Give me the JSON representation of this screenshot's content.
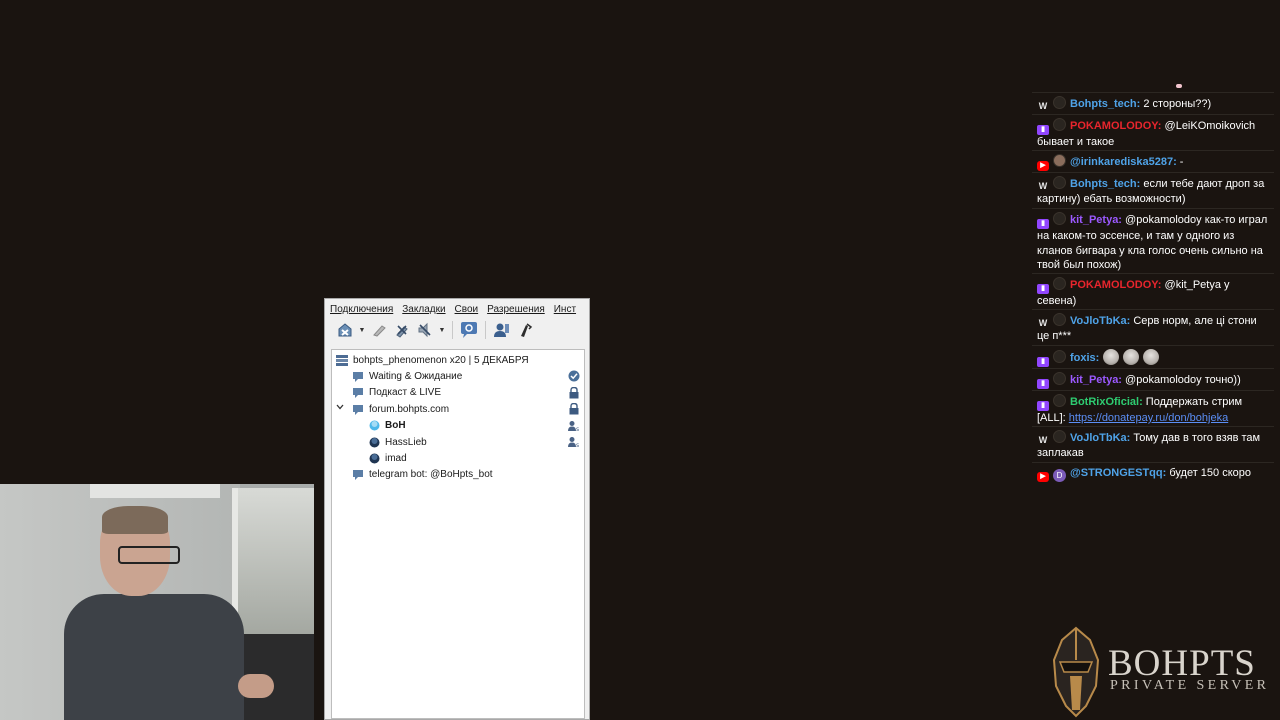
{
  "menu": [
    "Подключения",
    "Закладки",
    "Свои",
    "Разрешения",
    "Инст"
  ],
  "toolbar": {
    "icons": [
      "disconnect-icon",
      "bookmark-icon",
      "mute-mic-icon",
      "mute-speakers-icon",
      "away-icon",
      "contacts-icon",
      "whisper-icon"
    ]
  },
  "tree": {
    "server": "bohpts_phenomenon x20 | 5 ДЕКАБРЯ",
    "channels": [
      {
        "name": "Waiting & Ожидание",
        "right_icon": "check-icon"
      },
      {
        "name": "Подкаст & LIVE",
        "right_icon": "lock-icon"
      },
      {
        "name": "forum.bohpts.com",
        "right_icon": "lock-icon",
        "expanded": true,
        "users": [
          {
            "name": "BoH",
            "bold": true,
            "status": "talking",
            "right_icon": "server-admin-icon"
          },
          {
            "name": "HassLieb",
            "bold": false,
            "status": "idle",
            "right_icon": "server-admin-icon"
          },
          {
            "name": "imad",
            "bold": false,
            "status": "idle",
            "right_icon": ""
          }
        ]
      },
      {
        "name": "telegram bot: @BoHpts_bot",
        "right_icon": ""
      }
    ]
  },
  "colors": {
    "background": "#1a1410",
    "nick_blue": "#4fa3e8",
    "nick_red": "#e8252d",
    "nick_purple": "#9b59ff",
    "nick_green": "#2ecc71",
    "link": "#5b8ef5"
  },
  "chat": [
    {
      "platform": "w",
      "nick": "Bohpts_tech:",
      "color": "#4fa3e8",
      "text": "2 стороны??)"
    },
    {
      "platform": "tw",
      "nick": "POKAMOLODOY:",
      "color": "#e8252d",
      "text": "@LeiKOmoikovich бывает и такое"
    },
    {
      "platform": "yt",
      "nick": "@irinkarediska5287:",
      "color": "#4fa3e8",
      "text": "-"
    },
    {
      "platform": "w",
      "nick": "Bohpts_tech:",
      "color": "#4fa3e8",
      "text": "если тебе дают дроп за картину) ебать возможности)"
    },
    {
      "platform": "tw",
      "nick": "kit_Petya:",
      "color": "#9b59ff",
      "text": "@pokamolodoy как-то играл на каком-то эссенсе, и там у одного из кланов бигвара у кла голос очень сильно на твой был похож)"
    },
    {
      "platform": "tw",
      "nick": "POKAMOLODOY:",
      "color": "#e8252d",
      "text": "@kit_Petya у севена)"
    },
    {
      "platform": "w",
      "nick": "VoJloTbKa:",
      "color": "#4fa3e8",
      "text": "Серв норм, але ці стони це п***"
    },
    {
      "platform": "tw",
      "nick": "foxis:",
      "color": "#4fa3e8",
      "text": ""
    },
    {
      "platform": "tw",
      "nick": "kit_Petya:",
      "color": "#9b59ff",
      "text": "@pokamolodoy точно))"
    },
    {
      "platform": "tw",
      "nick": "BotRixOficial:",
      "color": "#2ecc71",
      "text": "Поддержать стрим [ALL]: ",
      "link": "https://donatepay.ru/don/bohjeka"
    },
    {
      "platform": "w",
      "nick": "VoJloTbKa:",
      "color": "#4fa3e8",
      "text": "Тому дав в того взяв там заплакав"
    },
    {
      "platform": "yt",
      "nick": "@STRONGESTqq:",
      "color": "#4fa3e8",
      "text": "будет 150 скоро",
      "avatar_letter": "D"
    }
  ],
  "logo": {
    "title": "BOHPTS",
    "subtitle": "PRIVATE SERVER"
  }
}
